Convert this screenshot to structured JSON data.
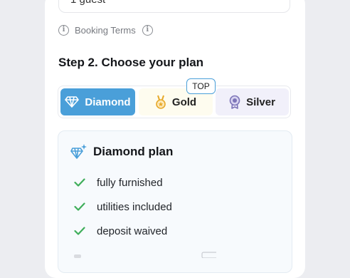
{
  "booking": {
    "guests_value": "1 guest",
    "terms_label": "Booking Terms"
  },
  "step": {
    "title": "Step 2. Choose your plan"
  },
  "plan_tabs": [
    {
      "label": "Diamond",
      "icon": "diamond-icon",
      "selected": true
    },
    {
      "label": "Gold",
      "icon": "gold-medal-icon",
      "selected": false
    },
    {
      "label": "Silver",
      "icon": "silver-medal-icon",
      "selected": false
    }
  ],
  "badge": {
    "label": "TOP"
  },
  "selected_plan": {
    "title": "Diamond plan",
    "icon": "sparkle-diamond-icon",
    "features": [
      "fully furnished",
      "utilities included",
      "deposit waived"
    ]
  },
  "colors": {
    "accent": "#4a9fd9",
    "check": "#3fae5a",
    "gold": "#e7a92b",
    "silver": "#7d74b8"
  }
}
